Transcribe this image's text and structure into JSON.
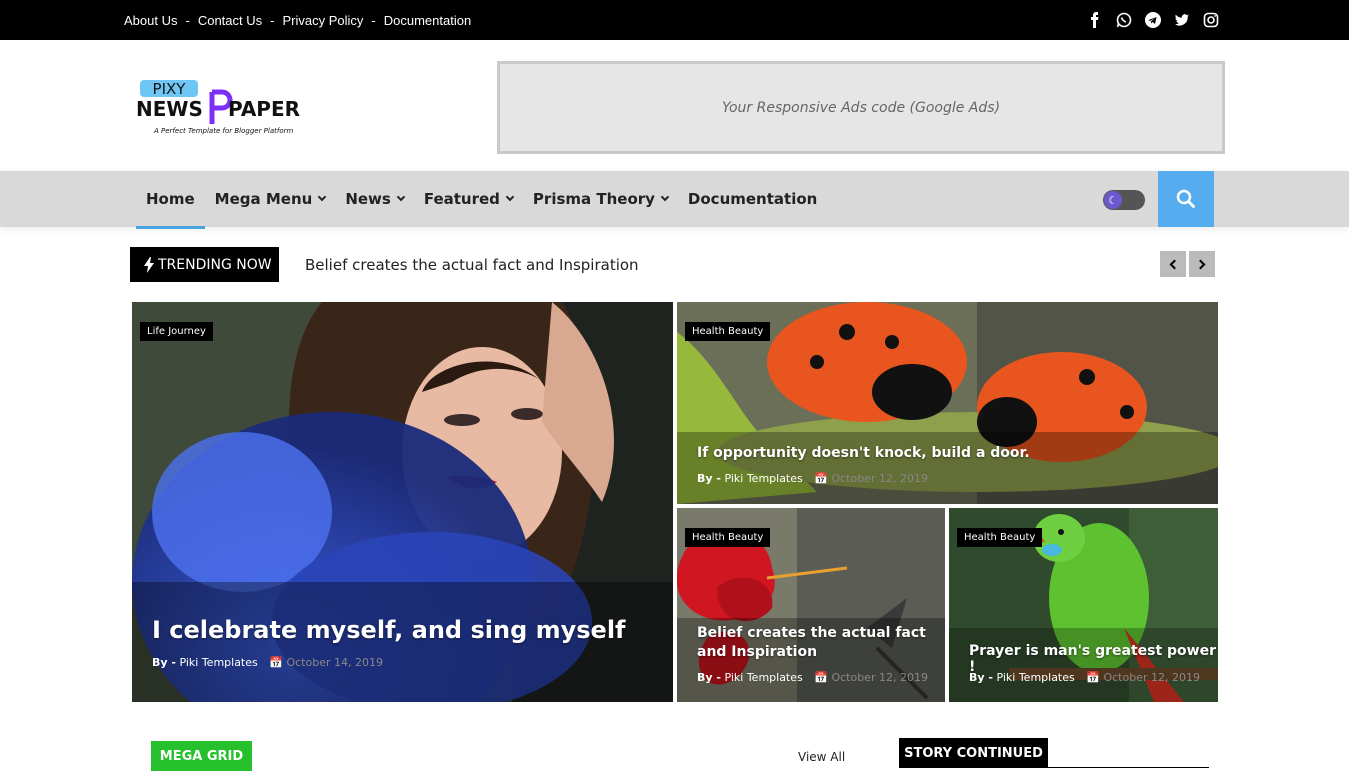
{
  "top_links": [
    "About Us",
    "Contact Us",
    "Privacy Policy",
    "Documentation"
  ],
  "social_icons": [
    "facebook-icon",
    "whatsapp-icon",
    "telegram-icon",
    "twitter-icon",
    "instagram-icon"
  ],
  "logo": {
    "line1": "PIXY",
    "line2a": "NEWS",
    "line2b": "PAPER",
    "tagline": "A Perfect Template for Blogger Platform"
  },
  "ad_text": "Your Responsive Ads code (Google Ads)",
  "nav": [
    {
      "label": "Home",
      "dropdown": false
    },
    {
      "label": "Mega Menu",
      "dropdown": true
    },
    {
      "label": "News",
      "dropdown": true
    },
    {
      "label": "Featured",
      "dropdown": true
    },
    {
      "label": "Prisma Theory",
      "dropdown": true
    },
    {
      "label": "Documentation",
      "dropdown": false
    }
  ],
  "trending": {
    "label": "TRENDING NOW",
    "text": "Belief creates the actual fact and Inspiration"
  },
  "featured": [
    {
      "tag": "Life Journey",
      "title": "I celebrate myself, and sing myself",
      "by": "By -",
      "author": "Piki Templates",
      "date": "October 14, 2019"
    },
    {
      "tag": "Health Beauty",
      "title": "If opportunity doesn't knock, build a door.",
      "by": "By -",
      "author": "Piki Templates",
      "date": "October 12, 2019"
    },
    {
      "tag": "Health Beauty",
      "title": "Belief creates the actual fact and Inspiration",
      "by": "By -",
      "author": "Piki Templates",
      "date": "October 12, 2019"
    },
    {
      "tag": "Health Beauty",
      "title": "Prayer is man's greatest power !",
      "by": "By -",
      "author": "Piki Templates",
      "date": "October 12, 2019"
    }
  ],
  "sections": {
    "mega_grid": "MEGA GRID",
    "view_all": "View All",
    "story_continued": "STORY CONTINUED"
  },
  "colors": {
    "accent": "#55acee",
    "green": "#25c02b",
    "black": "#000000"
  }
}
